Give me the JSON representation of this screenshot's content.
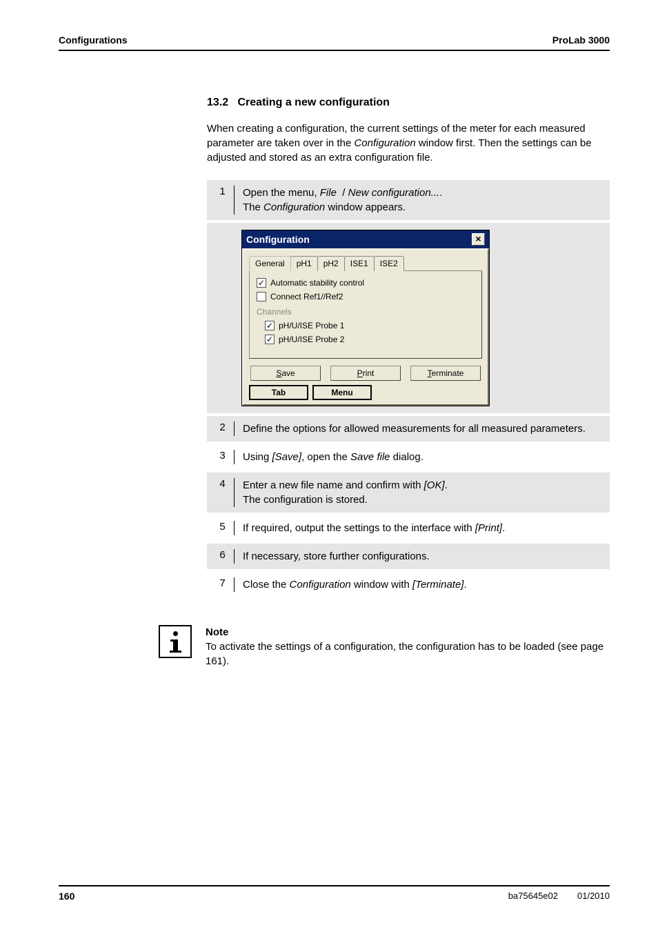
{
  "header": {
    "left": "Configurations",
    "right": "ProLab 3000"
  },
  "section": {
    "number": "13.2",
    "title": "Creating a new configuration",
    "intro_before": "When creating a configuration, the current settings of the meter for each measured parameter are taken over in the ",
    "intro_em": "Configuration",
    "intro_after": " window first. Then the settings can be adjusted and stored as an extra configuration file."
  },
  "steps": {
    "s1": {
      "n": "1",
      "t1": "Open the menu, ",
      "em1": "File",
      "sep": " / ",
      "em2": "New configuration...",
      "dot": ".",
      "t2": "The ",
      "em3": "Configuration",
      "t3": " window appears."
    },
    "s2": {
      "n": "2",
      "text": "Define the options for allowed measurements for all measured parameters."
    },
    "s3": {
      "n": "3",
      "t1": "Using ",
      "em1": "[Save]",
      "t2": ", open the ",
      "em2": "Save file",
      "t3": " dialog."
    },
    "s4": {
      "n": "4",
      "t1": "Enter a new file name and confirm with ",
      "em1": "[OK]",
      "dot": ".",
      "t2": "The configuration is stored."
    },
    "s5": {
      "n": "5",
      "t1": "If required, output the settings to the interface with ",
      "em1": "[Print]",
      "dot": "."
    },
    "s6": {
      "n": "6",
      "text": "If necessary, store further configurations."
    },
    "s7": {
      "n": "7",
      "t1": "Close the ",
      "em1": "Configuration",
      "t2": " window with ",
      "em2": "[Terminate]",
      "dot": "."
    }
  },
  "dialog": {
    "title": "Configuration",
    "close": "×",
    "tabs": {
      "general": "General",
      "ph1": "pH1",
      "ph2": "pH2",
      "ise1": "ISE1",
      "ise2": "ISE2"
    },
    "cb_auto_check": "✓",
    "cb_auto": "Automatic stability control",
    "cb_conn": "Connect Ref1//Ref2",
    "group": "Channels",
    "cb_p1_check": "✓",
    "cb_p1": "pH/U/ISE Probe 1",
    "cb_p2_check": "✓",
    "cb_p2": "pH/U/ISE Probe 2",
    "btn_save_m": "S",
    "btn_save": "ave",
    "btn_print_m": "P",
    "btn_print": "rint",
    "btn_term_m": "T",
    "btn_term": "erminate",
    "btn_tab": "Tab",
    "btn_menu": "Menu"
  },
  "note": {
    "title": "Note",
    "text": "To activate the settings of a configuration, the configuration has to be loaded (see page 161)."
  },
  "footer": {
    "page": "160",
    "code": "ba75645e02",
    "date": "01/2010"
  }
}
